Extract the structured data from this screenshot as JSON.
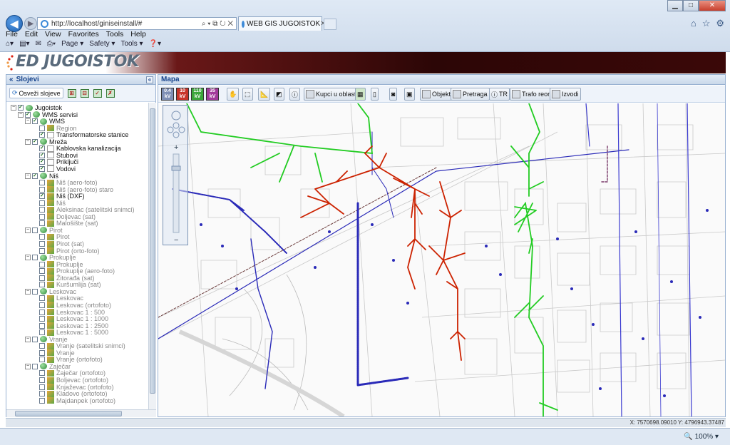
{
  "browser": {
    "address": "http://localhost/giniseinstall/#",
    "address_controls": "⌕ ▾ ⧉ ↻ ✕",
    "tab_title": "WEB GIS JUGOISTOK",
    "menu": [
      "File",
      "Edit",
      "View",
      "Favorites",
      "Tools",
      "Help"
    ],
    "toolbar": [
      "Page ▾",
      "Safety ▾",
      "Tools ▾"
    ],
    "zoom": "100%"
  },
  "app": {
    "logo_text": "ED JUGOISTOK"
  },
  "layers_panel": {
    "title": "Slojevi",
    "refresh_button": "Osveži slojeve",
    "tree": [
      {
        "level": 0,
        "label": "Jugoistok",
        "checked": true,
        "icon": "globe",
        "exp": "−",
        "active": true
      },
      {
        "level": 1,
        "label": "WMS servisi",
        "checked": true,
        "icon": "globe",
        "exp": "−",
        "active": true
      },
      {
        "level": 2,
        "label": "WMS",
        "checked": true,
        "icon": "globe",
        "exp": "−",
        "active": true
      },
      {
        "level": 3,
        "label": "Region",
        "checked": false,
        "icon": "map",
        "active": false
      },
      {
        "level": 3,
        "label": "Transformatorske stanice",
        "checked": true,
        "icon": "page",
        "active": true
      },
      {
        "level": 2,
        "label": "Mreža",
        "checked": true,
        "icon": "globe",
        "exp": "−",
        "active": true
      },
      {
        "level": 3,
        "label": "Kablovska kanalizacija",
        "checked": true,
        "icon": "page",
        "active": true
      },
      {
        "level": 3,
        "label": "Stubovi",
        "checked": true,
        "icon": "page",
        "active": true
      },
      {
        "level": 3,
        "label": "Priključi",
        "checked": true,
        "icon": "page",
        "active": true
      },
      {
        "level": 3,
        "label": "Vodovi",
        "checked": true,
        "icon": "page",
        "active": true
      },
      {
        "level": 2,
        "label": "Niš",
        "checked": true,
        "icon": "globe",
        "exp": "−",
        "active": true
      },
      {
        "level": 3,
        "label": "Niš (aero-foto)",
        "checked": false,
        "icon": "map",
        "active": false
      },
      {
        "level": 3,
        "label": "Niš (aero-foto) staro",
        "checked": false,
        "icon": "map",
        "active": false
      },
      {
        "level": 3,
        "label": "Niš (DXF)",
        "checked": true,
        "icon": "map",
        "active": true
      },
      {
        "level": 3,
        "label": "Niš",
        "checked": false,
        "icon": "map",
        "active": false
      },
      {
        "level": 3,
        "label": "Aleksinac (satelitski snimci)",
        "checked": false,
        "icon": "map",
        "active": false
      },
      {
        "level": 3,
        "label": "Doljevac (sat)",
        "checked": false,
        "icon": "map",
        "active": false
      },
      {
        "level": 3,
        "label": "Malošište (sat)",
        "checked": false,
        "icon": "map",
        "active": false
      },
      {
        "level": 2,
        "label": "Pirot",
        "checked": false,
        "icon": "globe",
        "exp": "−",
        "active": false
      },
      {
        "level": 3,
        "label": "Pirot",
        "checked": false,
        "icon": "map",
        "active": false
      },
      {
        "level": 3,
        "label": "Pirot (sat)",
        "checked": false,
        "icon": "map",
        "active": false
      },
      {
        "level": 3,
        "label": "Pirot (orto-foto)",
        "checked": false,
        "icon": "map",
        "active": false
      },
      {
        "level": 2,
        "label": "Prokuplje",
        "checked": false,
        "icon": "globe",
        "exp": "−",
        "active": false
      },
      {
        "level": 3,
        "label": "Prokuplje",
        "checked": false,
        "icon": "map",
        "active": false
      },
      {
        "level": 3,
        "label": "Prokuplje (aero-foto)",
        "checked": false,
        "icon": "map",
        "active": false
      },
      {
        "level": 3,
        "label": "Žitorađa (sat)",
        "checked": false,
        "icon": "map",
        "active": false
      },
      {
        "level": 3,
        "label": "Kuršumlija (sat)",
        "checked": false,
        "icon": "map",
        "active": false
      },
      {
        "level": 2,
        "label": "Leskovac",
        "checked": false,
        "icon": "globe",
        "exp": "−",
        "active": false
      },
      {
        "level": 3,
        "label": "Leskovac",
        "checked": false,
        "icon": "map",
        "active": false
      },
      {
        "level": 3,
        "label": "Leskovac (ortofoto)",
        "checked": false,
        "icon": "map",
        "active": false
      },
      {
        "level": 3,
        "label": "Leskovac 1 : 500",
        "checked": false,
        "icon": "map",
        "active": false
      },
      {
        "level": 3,
        "label": "Leskovac 1 : 1000",
        "checked": false,
        "icon": "map",
        "active": false
      },
      {
        "level": 3,
        "label": "Leskovac 1 : 2500",
        "checked": false,
        "icon": "map",
        "active": false
      },
      {
        "level": 3,
        "label": "Leskovac 1 : 5000",
        "checked": false,
        "icon": "map",
        "active": false
      },
      {
        "level": 2,
        "label": "Vranje",
        "checked": false,
        "icon": "globe",
        "exp": "−",
        "active": false
      },
      {
        "level": 3,
        "label": "Vranje (satelitski snimci)",
        "checked": false,
        "icon": "map",
        "active": false
      },
      {
        "level": 3,
        "label": "Vranje",
        "checked": false,
        "icon": "map",
        "active": false
      },
      {
        "level": 3,
        "label": "Vranje (ortofoto)",
        "checked": false,
        "icon": "map",
        "active": false
      },
      {
        "level": 2,
        "label": "Zaječar",
        "checked": false,
        "icon": "globe",
        "exp": "−",
        "active": false
      },
      {
        "level": 3,
        "label": "Zaječar (ortofoto)",
        "checked": false,
        "icon": "map",
        "active": false
      },
      {
        "level": 3,
        "label": "Boljevac (ortofoto)",
        "checked": false,
        "icon": "map",
        "active": false
      },
      {
        "level": 3,
        "label": "Knjaževac (ortofoto)",
        "checked": false,
        "icon": "map",
        "active": false
      },
      {
        "level": 3,
        "label": "Kladovo (ortofoto)",
        "checked": false,
        "icon": "map",
        "active": false
      },
      {
        "level": 3,
        "label": "Majdanpek (ortofoto)",
        "checked": false,
        "icon": "map",
        "active": false
      }
    ]
  },
  "map_panel": {
    "title": "Mapa",
    "color_buttons": [
      "0.4 kV",
      "10 kV",
      "110 kV",
      "35 kV"
    ],
    "buttons": {
      "kupci": "Kupci u oblasti",
      "objekti": "Objekti",
      "pretraga": "Pretraga",
      "tr": "TR",
      "trafo": "Trafo reoni",
      "izvodi": "Izvodi"
    }
  },
  "status": {
    "coords": "X: 7570698.09010 Y: 4796943.37487"
  },
  "colors": {
    "network_green": "#22cc22",
    "network_red": "#cc2200",
    "network_blue": "#2a2ab8",
    "banner_dark": "#3b0808"
  }
}
